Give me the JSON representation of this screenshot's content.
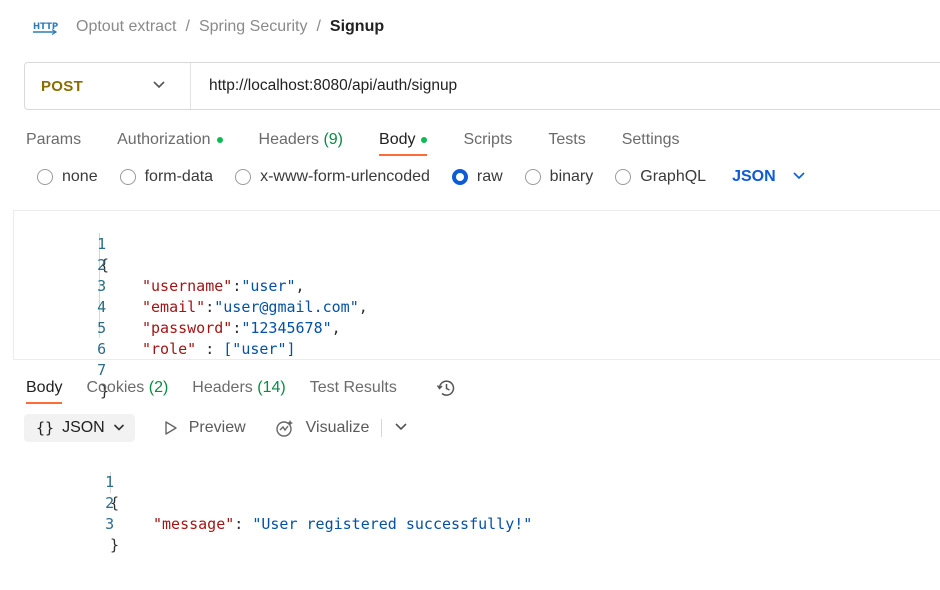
{
  "breadcrumb": {
    "icon": "http-icon",
    "items": [
      "Optout extract",
      "Spring Security"
    ],
    "separator": "/",
    "current": "Signup"
  },
  "request": {
    "method": "POST",
    "url": "http://localhost:8080/api/auth/signup"
  },
  "tabs": [
    {
      "label": "Params"
    },
    {
      "label": "Authorization",
      "dot": true
    },
    {
      "label": "Headers",
      "count": "(9)"
    },
    {
      "label": "Body",
      "dot": true,
      "active": true
    },
    {
      "label": "Scripts"
    },
    {
      "label": "Tests"
    },
    {
      "label": "Settings"
    }
  ],
  "body_types": {
    "options": [
      "none",
      "form-data",
      "x-www-form-urlencoded",
      "raw",
      "binary",
      "GraphQL"
    ],
    "selected": "raw",
    "language": "JSON"
  },
  "request_body": {
    "line_numbers": [
      "1",
      "2",
      "3",
      "4",
      "5",
      "6",
      "7"
    ],
    "open_brace": "{",
    "close_brace": "}",
    "fields": [
      {
        "key": "\"username\"",
        "sep": ":",
        "value": "\"user\"",
        "end": ","
      },
      {
        "key": "\"email\"",
        "sep": ":",
        "value": "\"user@gmail.com\"",
        "end": ","
      },
      {
        "key": "\"password\"",
        "sep": ":",
        "value": "\"12345678\"",
        "end": ","
      },
      {
        "key": "\"role\"",
        "sep": " : ",
        "value": "[\"user\"]",
        "end": ""
      }
    ]
  },
  "response_tabs": [
    {
      "label": "Body",
      "active": true
    },
    {
      "label": "Cookies",
      "count": "(2)"
    },
    {
      "label": "Headers",
      "count": "(14)"
    },
    {
      "label": "Test Results"
    }
  ],
  "response_toolbar": {
    "format_braces": "{}",
    "format": "JSON",
    "preview": "Preview",
    "visualize": "Visualize"
  },
  "response_body": {
    "line_numbers": [
      "1",
      "2",
      "3"
    ],
    "open_brace": "{",
    "close_brace": "}",
    "key": "\"message\"",
    "sep": ": ",
    "value": "\"User registered successfully!\""
  },
  "colors": {
    "accent": "#ff6c37",
    "method": "#8a6d00",
    "link_blue": "#0d5bd7",
    "dot_green": "#0cbb52",
    "json_key": "#a31515",
    "json_string": "#0451a5"
  }
}
